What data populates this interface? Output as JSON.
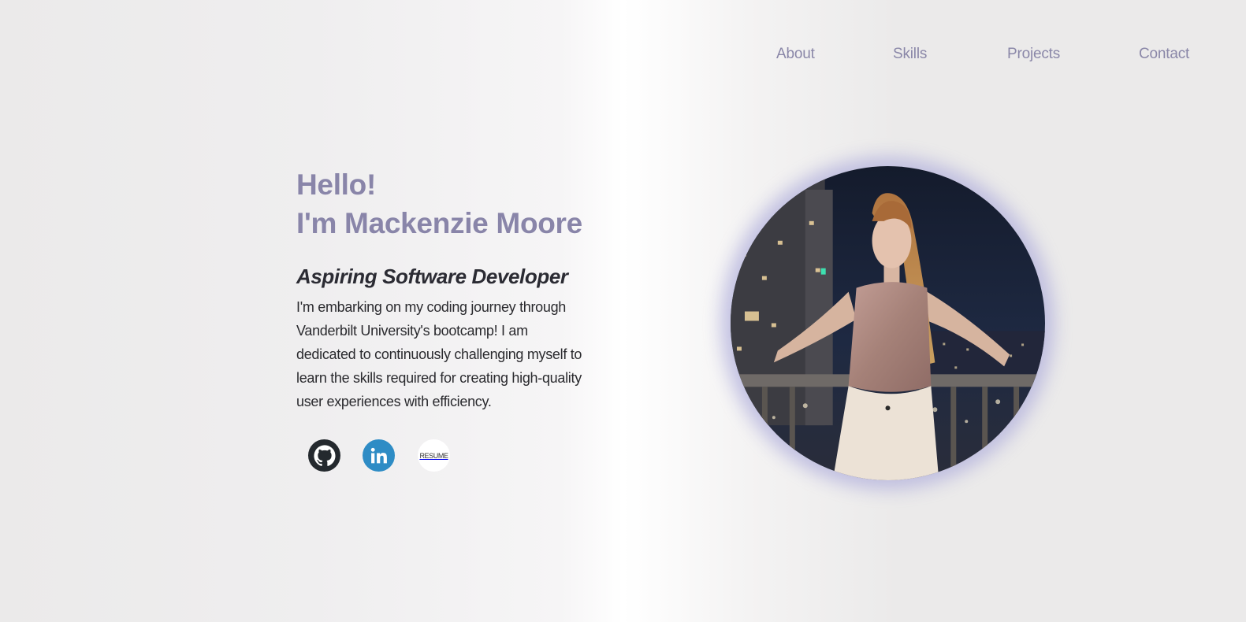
{
  "nav": {
    "items": [
      "About",
      "Skills",
      "Projects",
      "Contact"
    ]
  },
  "hero": {
    "greeting_line1": "Hello!",
    "greeting_line2": "I'm Mackenzie Moore",
    "role": "Aspiring Software Developer",
    "bio": "I'm embarking on my coding journey through Vanderbilt University's bootcamp! I am dedicated to continuously challenging myself to learn the skills required for creating high-quality user experiences with efficiency."
  },
  "socials": {
    "github_icon": "github-icon",
    "linkedin_icon": "linkedin-icon",
    "resume_label": "RESUME"
  },
  "colors": {
    "accent": "#8985a9",
    "nav_text": "#8a87a8",
    "linkedin": "#2e8cc5",
    "github": "#24292e"
  },
  "photo": {
    "icon": "profile-photo"
  }
}
